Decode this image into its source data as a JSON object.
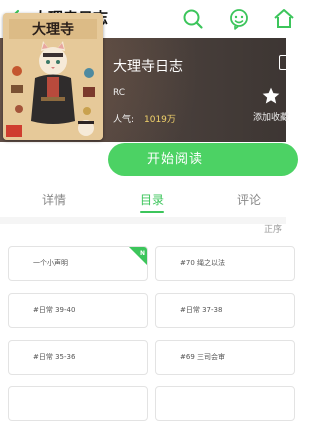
{
  "header": {
    "title": "大理寺日志",
    "icons": [
      "back-arrow-icon",
      "search-icon",
      "face-icon",
      "home-icon"
    ]
  },
  "book": {
    "title": "大理寺日志",
    "author": "RC",
    "popularity_label": "人气:",
    "popularity_value": "1019万",
    "favorite_label": "添加收藏"
  },
  "actions": {
    "start_reading": "开始阅读"
  },
  "tabs": [
    {
      "label": "详情",
      "active": false
    },
    {
      "label": "目录",
      "active": true
    },
    {
      "label": "评论",
      "active": false
    }
  ],
  "catalog": {
    "sort_label": "正序",
    "chapters": [
      {
        "title": "一个小声明",
        "new": true
      },
      {
        "title": "#70 绳之以法",
        "new": false
      },
      {
        "title": "#日常 39-40",
        "new": false
      },
      {
        "title": "#日常 37-38",
        "new": false
      },
      {
        "title": "#日常 35-36",
        "new": false
      },
      {
        "title": "#69 三司会审",
        "new": false
      }
    ],
    "new_badge": "N"
  },
  "colors": {
    "accent": "#3cc55b",
    "button": "#4cd264",
    "popularity": "#f2d36b"
  }
}
